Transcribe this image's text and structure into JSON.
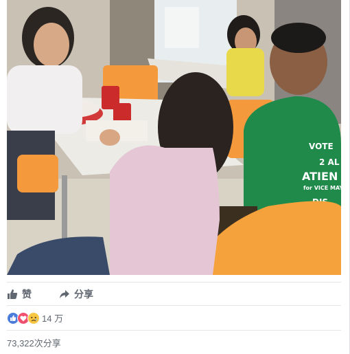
{
  "post": {
    "photo_alt": "photo",
    "shirt_text": [
      "VOTE",
      "2 AL",
      "ATIEN",
      "for VICE MAYO",
      "DIS"
    ]
  },
  "actions": {
    "like_label": "赞",
    "share_label": "分享"
  },
  "reactions": {
    "icons": [
      "like-reaction-icon",
      "love-reaction-icon",
      "sad-reaction-icon"
    ],
    "count": "14 万"
  },
  "shares": {
    "text": "73,322次分享"
  },
  "colors": {
    "like_blue": "#4a7ddb",
    "love_red": "#f0506e",
    "sad_yellow": "#f7c744",
    "muted_text": "#616770"
  }
}
